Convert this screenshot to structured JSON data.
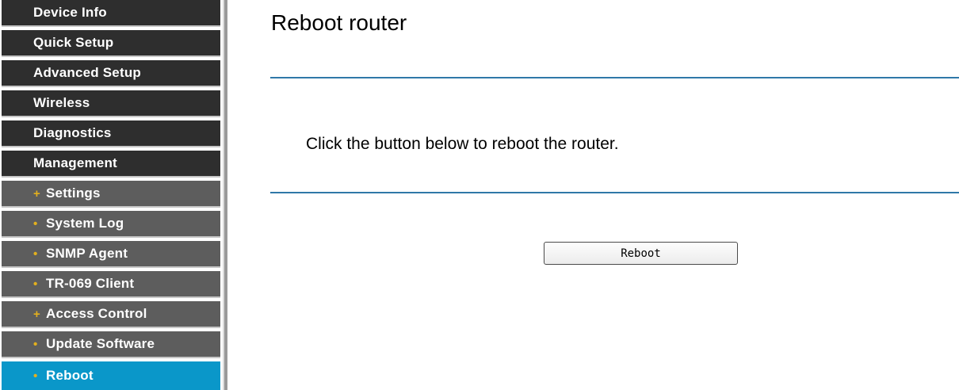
{
  "sidebar": {
    "items": [
      {
        "label": "Device Info"
      },
      {
        "label": "Quick Setup"
      },
      {
        "label": "Advanced Setup"
      },
      {
        "label": "Wireless"
      },
      {
        "label": "Diagnostics"
      },
      {
        "label": "Management"
      },
      {
        "label": "Settings",
        "marker": "+"
      },
      {
        "label": "System Log",
        "marker": "•"
      },
      {
        "label": "SNMP Agent",
        "marker": "•"
      },
      {
        "label": "TR-069 Client",
        "marker": "•"
      },
      {
        "label": "Access Control",
        "marker": "+"
      },
      {
        "label": "Update Software",
        "marker": "•"
      },
      {
        "label": "Reboot",
        "marker": "•",
        "active": true
      }
    ]
  },
  "main": {
    "title": "Reboot router",
    "instruction": "Click the button below to reboot the router.",
    "reboot_label": "Reboot"
  },
  "colors": {
    "menu_top_bg": "#2e2e2e",
    "menu_sub_bg": "#5d5d5d",
    "menu_active_bg": "#0a97c9",
    "bullet": "#e3b01e",
    "rule": "#2f78a8"
  }
}
